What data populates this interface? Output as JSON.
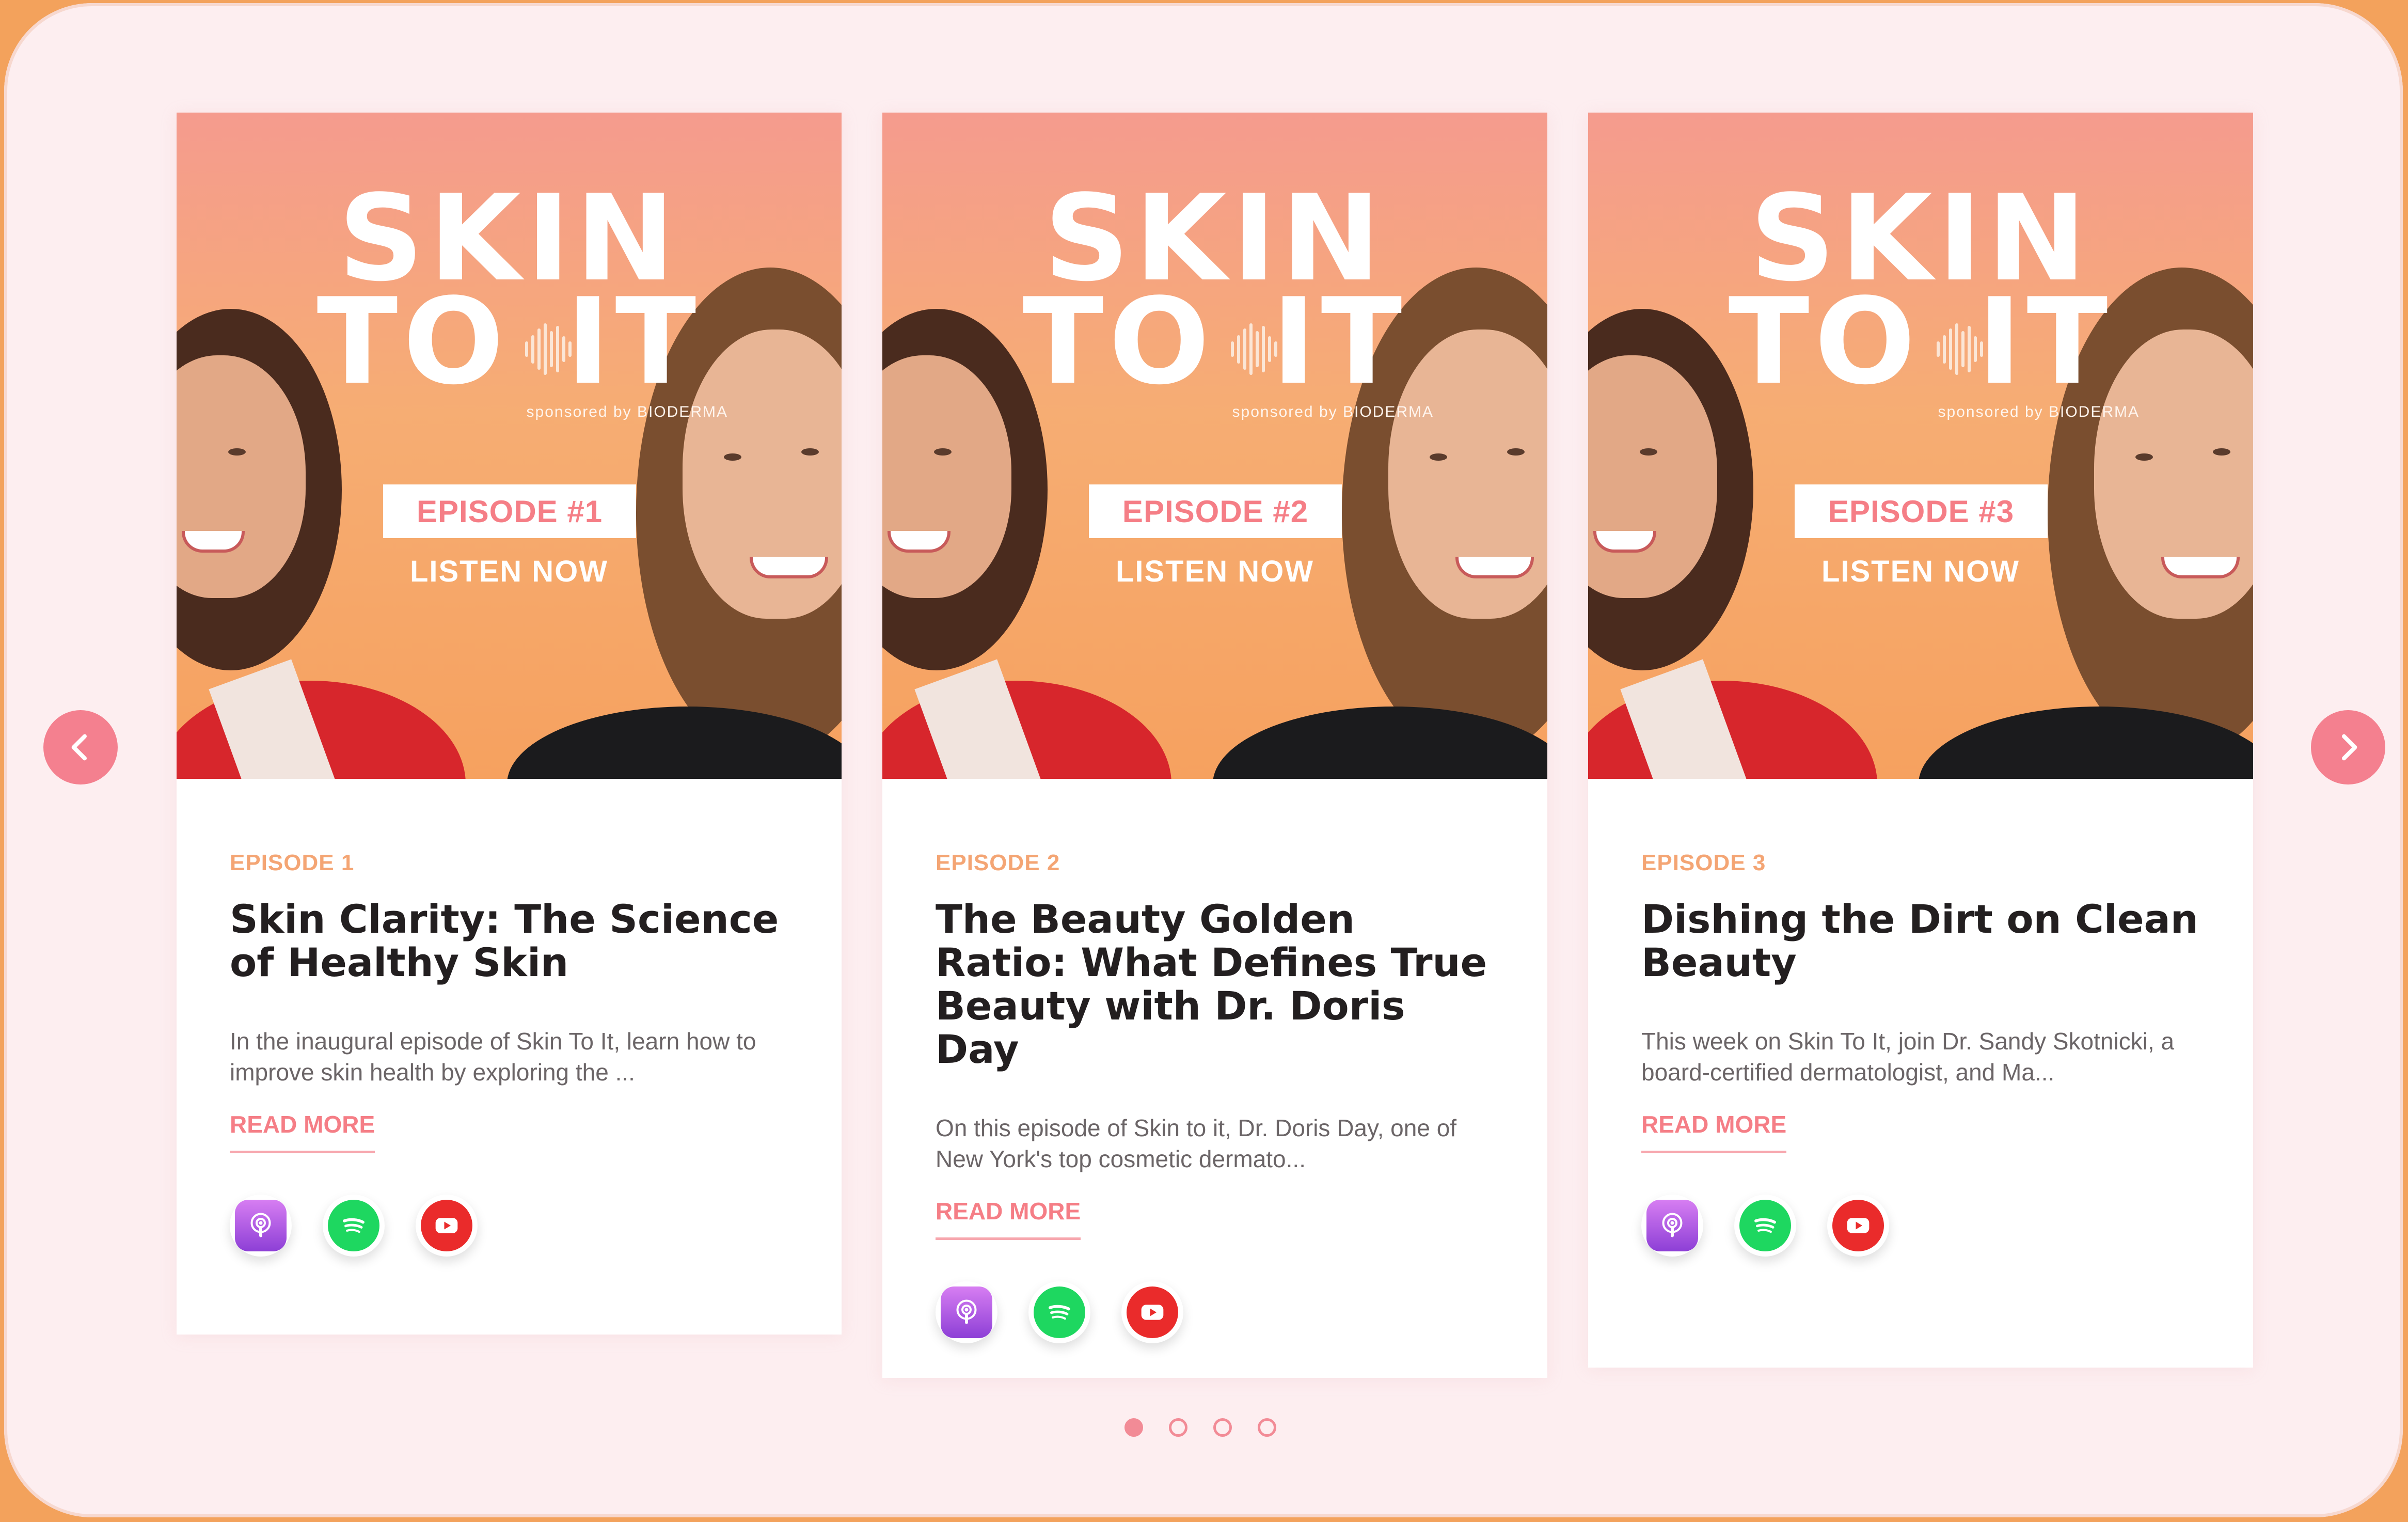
{
  "carousel": {
    "prev_icon": "chevron-left-icon",
    "next_icon": "chevron-right-icon",
    "accent_color": "#f4808f",
    "slides_total": 4,
    "active_slide": 1
  },
  "cover": {
    "title_line1": "SKIN",
    "title_line2_left": "TO",
    "title_line2_right": "IT",
    "sponsor": "sponsored by BIODERMA",
    "listen_label": "LISTEN NOW"
  },
  "episodes": [
    {
      "badge": "EPISODE #1",
      "label": "EPISODE 1",
      "title": "Skin Clarity: The Science of Healthy Skin",
      "description": "In the inaugural episode of Skin To It, learn how to improve skin health by exploring the ...",
      "read_more": "READ MORE"
    },
    {
      "badge": "EPISODE #2",
      "label": "EPISODE 2",
      "title": "The Beauty Golden Ratio: What Defines True Beauty with Dr. Doris Day",
      "description": "On this episode of Skin to it, Dr. Doris Day, one of New York's top cosmetic dermato...",
      "read_more": "READ MORE"
    },
    {
      "badge": "EPISODE #3",
      "label": "EPISODE 3",
      "title": "Dishing the Dirt on Clean Beauty",
      "description": "This week on Skin To It, join Dr. Sandy Skotnicki, a board-certified dermatologist, and Ma...",
      "read_more": "READ MORE"
    }
  ],
  "platform_icons": [
    "apple-podcasts-icon",
    "spotify-icon",
    "youtube-icon"
  ],
  "colors": {
    "episode_label": "#f4a574",
    "read_more": "#f57e86",
    "spotify": "#1ed760",
    "youtube": "#ea2b2b",
    "podcasts": "#a24ddf"
  }
}
